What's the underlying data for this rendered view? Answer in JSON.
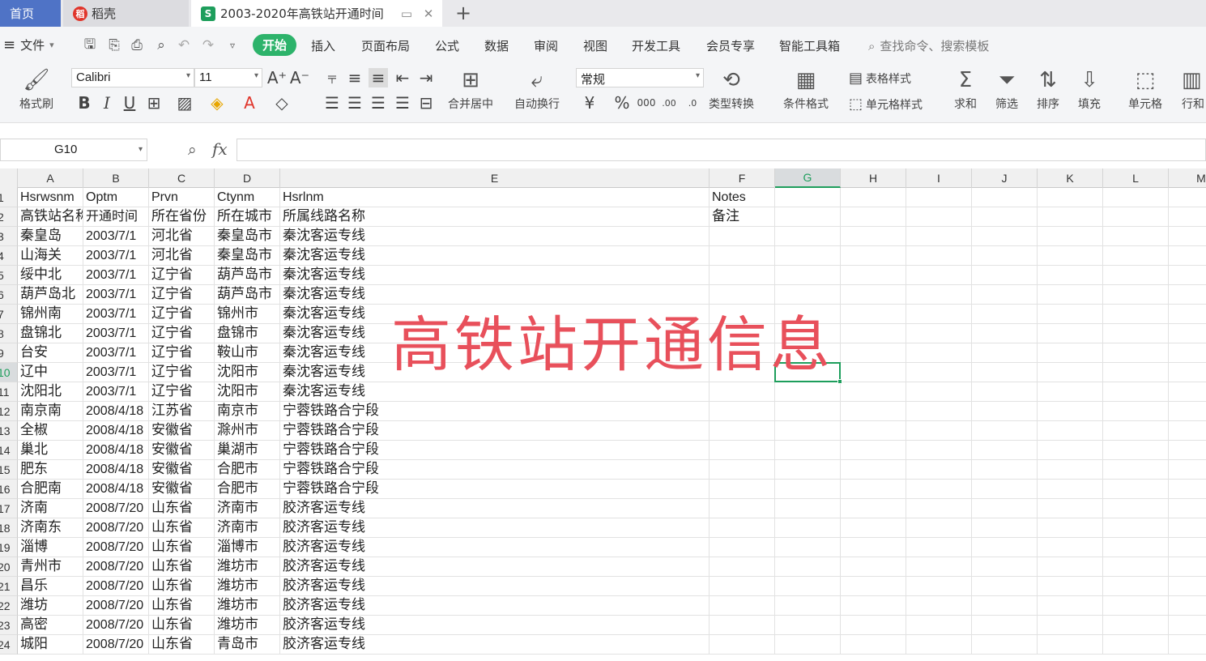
{
  "tabs": {
    "home": "首页",
    "doc": "稻壳",
    "file": "2003-2020年高铁站开通时间"
  },
  "menu": {
    "file": "文件",
    "items": [
      "开始",
      "插入",
      "页面布局",
      "公式",
      "数据",
      "审阅",
      "视图",
      "开发工具",
      "会员专享",
      "智能工具箱"
    ],
    "search": "查找命令、搜索模板"
  },
  "ribbon": {
    "format_painter": "格式刷",
    "font_name": "Calibri",
    "font_size": "11",
    "merge_center": "合并居中",
    "auto_wrap": "自动换行",
    "number_format": "常规",
    "type_convert": "类型转换",
    "cond_format": "条件格式",
    "table_style": "表格样式",
    "cell_style": "单元格样式",
    "sum": "求和",
    "filter": "筛选",
    "sort": "排序",
    "fill": "填充",
    "cell": "单元格",
    "row_col": "行和"
  },
  "formula_bar": {
    "name_box": "G10",
    "fx": "fx",
    "value": ""
  },
  "columns": [
    "A",
    "B",
    "C",
    "D",
    "E",
    "F",
    "G",
    "H",
    "I",
    "J",
    "K",
    "L",
    "M"
  ],
  "selected_cell": "G10",
  "rows": [
    {
      "n": "1",
      "a": "Hsrwsnm",
      "b": "Optm",
      "c": "Prvn",
      "d": "Ctynm",
      "e": "Hsrlnm",
      "f": "Notes"
    },
    {
      "n": "2",
      "a": "高铁站名称",
      "b": "开通时间",
      "c": "所在省份",
      "d": "所在城市",
      "e": "所属线路名称",
      "f": "备注"
    },
    {
      "n": "3",
      "a": "秦皇岛",
      "b": "2003/7/1",
      "c": "河北省",
      "d": "秦皇岛市",
      "e": "秦沈客运专线",
      "f": ""
    },
    {
      "n": "4",
      "a": "山海关",
      "b": "2003/7/1",
      "c": "河北省",
      "d": "秦皇岛市",
      "e": "秦沈客运专线",
      "f": ""
    },
    {
      "n": "5",
      "a": "绥中北",
      "b": "2003/7/1",
      "c": "辽宁省",
      "d": "葫芦岛市",
      "e": "秦沈客运专线",
      "f": ""
    },
    {
      "n": "6",
      "a": "葫芦岛北",
      "b": "2003/7/1",
      "c": "辽宁省",
      "d": "葫芦岛市",
      "e": "秦沈客运专线",
      "f": ""
    },
    {
      "n": "7",
      "a": "锦州南",
      "b": "2003/7/1",
      "c": "辽宁省",
      "d": "锦州市",
      "e": "秦沈客运专线",
      "f": ""
    },
    {
      "n": "8",
      "a": "盘锦北",
      "b": "2003/7/1",
      "c": "辽宁省",
      "d": "盘锦市",
      "e": "秦沈客运专线",
      "f": ""
    },
    {
      "n": "9",
      "a": "台安",
      "b": "2003/7/1",
      "c": "辽宁省",
      "d": "鞍山市",
      "e": "秦沈客运专线",
      "f": ""
    },
    {
      "n": "10",
      "a": "辽中",
      "b": "2003/7/1",
      "c": "辽宁省",
      "d": "沈阳市",
      "e": "秦沈客运专线",
      "f": ""
    },
    {
      "n": "11",
      "a": "沈阳北",
      "b": "2003/7/1",
      "c": "辽宁省",
      "d": "沈阳市",
      "e": "秦沈客运专线",
      "f": ""
    },
    {
      "n": "12",
      "a": "南京南",
      "b": "2008/4/18",
      "c": "江苏省",
      "d": "南京市",
      "e": "宁蓉铁路合宁段",
      "f": ""
    },
    {
      "n": "13",
      "a": "全椒",
      "b": "2008/4/18",
      "c": "安徽省",
      "d": "滁州市",
      "e": "宁蓉铁路合宁段",
      "f": ""
    },
    {
      "n": "14",
      "a": "巢北",
      "b": "2008/4/18",
      "c": "安徽省",
      "d": "巢湖市",
      "e": "宁蓉铁路合宁段",
      "f": ""
    },
    {
      "n": "15",
      "a": "肥东",
      "b": "2008/4/18",
      "c": "安徽省",
      "d": "合肥市",
      "e": "宁蓉铁路合宁段",
      "f": ""
    },
    {
      "n": "16",
      "a": "合肥南",
      "b": "2008/4/18",
      "c": "安徽省",
      "d": "合肥市",
      "e": "宁蓉铁路合宁段",
      "f": ""
    },
    {
      "n": "17",
      "a": "济南",
      "b": "2008/7/20",
      "c": "山东省",
      "d": "济南市",
      "e": "胶济客运专线",
      "f": ""
    },
    {
      "n": "18",
      "a": "济南东",
      "b": "2008/7/20",
      "c": "山东省",
      "d": "济南市",
      "e": "胶济客运专线",
      "f": ""
    },
    {
      "n": "19",
      "a": "淄博",
      "b": "2008/7/20",
      "c": "山东省",
      "d": "淄博市",
      "e": "胶济客运专线",
      "f": ""
    },
    {
      "n": "20",
      "a": "青州市",
      "b": "2008/7/20",
      "c": "山东省",
      "d": "潍坊市",
      "e": "胶济客运专线",
      "f": ""
    },
    {
      "n": "21",
      "a": "昌乐",
      "b": "2008/7/20",
      "c": "山东省",
      "d": "潍坊市",
      "e": "胶济客运专线",
      "f": ""
    },
    {
      "n": "22",
      "a": "潍坊",
      "b": "2008/7/20",
      "c": "山东省",
      "d": "潍坊市",
      "e": "胶济客运专线",
      "f": ""
    },
    {
      "n": "23",
      "a": "高密",
      "b": "2008/7/20",
      "c": "山东省",
      "d": "潍坊市",
      "e": "胶济客运专线",
      "f": ""
    },
    {
      "n": "24",
      "a": "城阳",
      "b": "2008/7/20",
      "c": "山东省",
      "d": "青岛市",
      "e": "胶济客运专线",
      "f": ""
    }
  ],
  "overlay_title": "高铁站开通信息",
  "colors": {
    "home_tab": "#4f73c6",
    "accent_green": "#2db36b",
    "overlay_red": "#e8505b"
  }
}
